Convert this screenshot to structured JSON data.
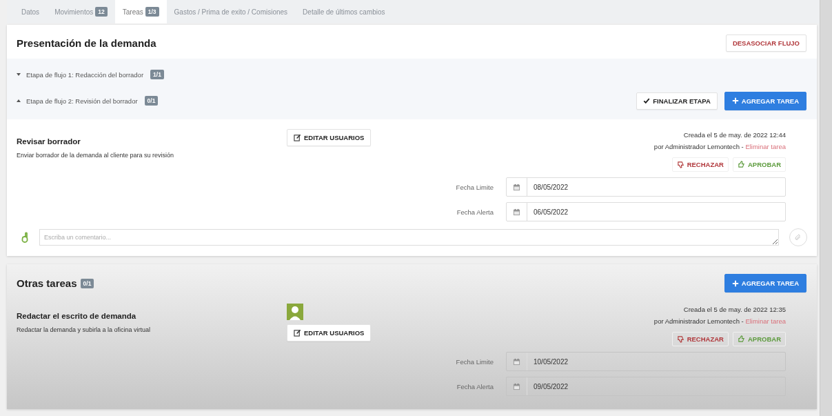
{
  "tabs": [
    {
      "label": "Datos",
      "selected": false
    },
    {
      "label": "Movimientos",
      "count": "12",
      "selected": false
    },
    {
      "label": "Tareas",
      "count": "1/3",
      "selected": true
    },
    {
      "label": "Gastos / Prima de exito / Comisiones",
      "selected": false
    },
    {
      "label": "Detalle de últimos cambios",
      "selected": false
    }
  ],
  "flow": {
    "title": "Presentación de la demanda",
    "unlink_button": "DESASOCIAR FLUJO",
    "stages": [
      {
        "label": "Etapa de flujo 1: Redacción del borrador",
        "count": "1/1",
        "expanded": false
      },
      {
        "label": "Etapa de flujo 2: Revisión del borrador",
        "count": "0/1",
        "expanded": true
      }
    ],
    "finalize_button": "FINALIZAR ETAPA",
    "add_button": "AGREGAR TAREA",
    "tasks": [
      {
        "title": "Revisar borrador",
        "description": "Enviar borrador de la demanda al cliente para su revisión",
        "edit_button": "EDITAR USUARIOS",
        "created": "Creada el 5 de may. de 2022 12:44",
        "author": "por Administrador Lemontech - ",
        "delete_link": "Eliminar tarea",
        "reject_button": "RECHAZAR",
        "approve_button": "APROBAR",
        "fields": [
          {
            "label": "Fecha Limite",
            "value": "08/05/2022"
          },
          {
            "label": "Fecha Alerta",
            "value": "06/05/2022"
          }
        ]
      }
    ],
    "comment": {
      "placeholder": "Escriba un comentario..."
    }
  },
  "other": {
    "title": "Otras tareas",
    "count": "0/1",
    "add_button": "AGREGAR TAREA",
    "tasks": [
      {
        "title": "Redactar el escrito de demanda",
        "description": "Redactar la demanda y subirla a la oficina virtual",
        "avatar": true,
        "edit_button": "EDITAR USUARIOS",
        "created": "Creada el 5 de may. de 2022 12:35",
        "author": "por Administrador Lemontech - ",
        "delete_link": "Eliminar tarea",
        "reject_button": "RECHAZAR",
        "approve_button": "APROBAR",
        "fields": [
          {
            "label": "Fecha Limite",
            "value": "10/05/2022"
          },
          {
            "label": "Fecha Alerta",
            "value": "09/05/2022"
          }
        ]
      }
    ]
  }
}
